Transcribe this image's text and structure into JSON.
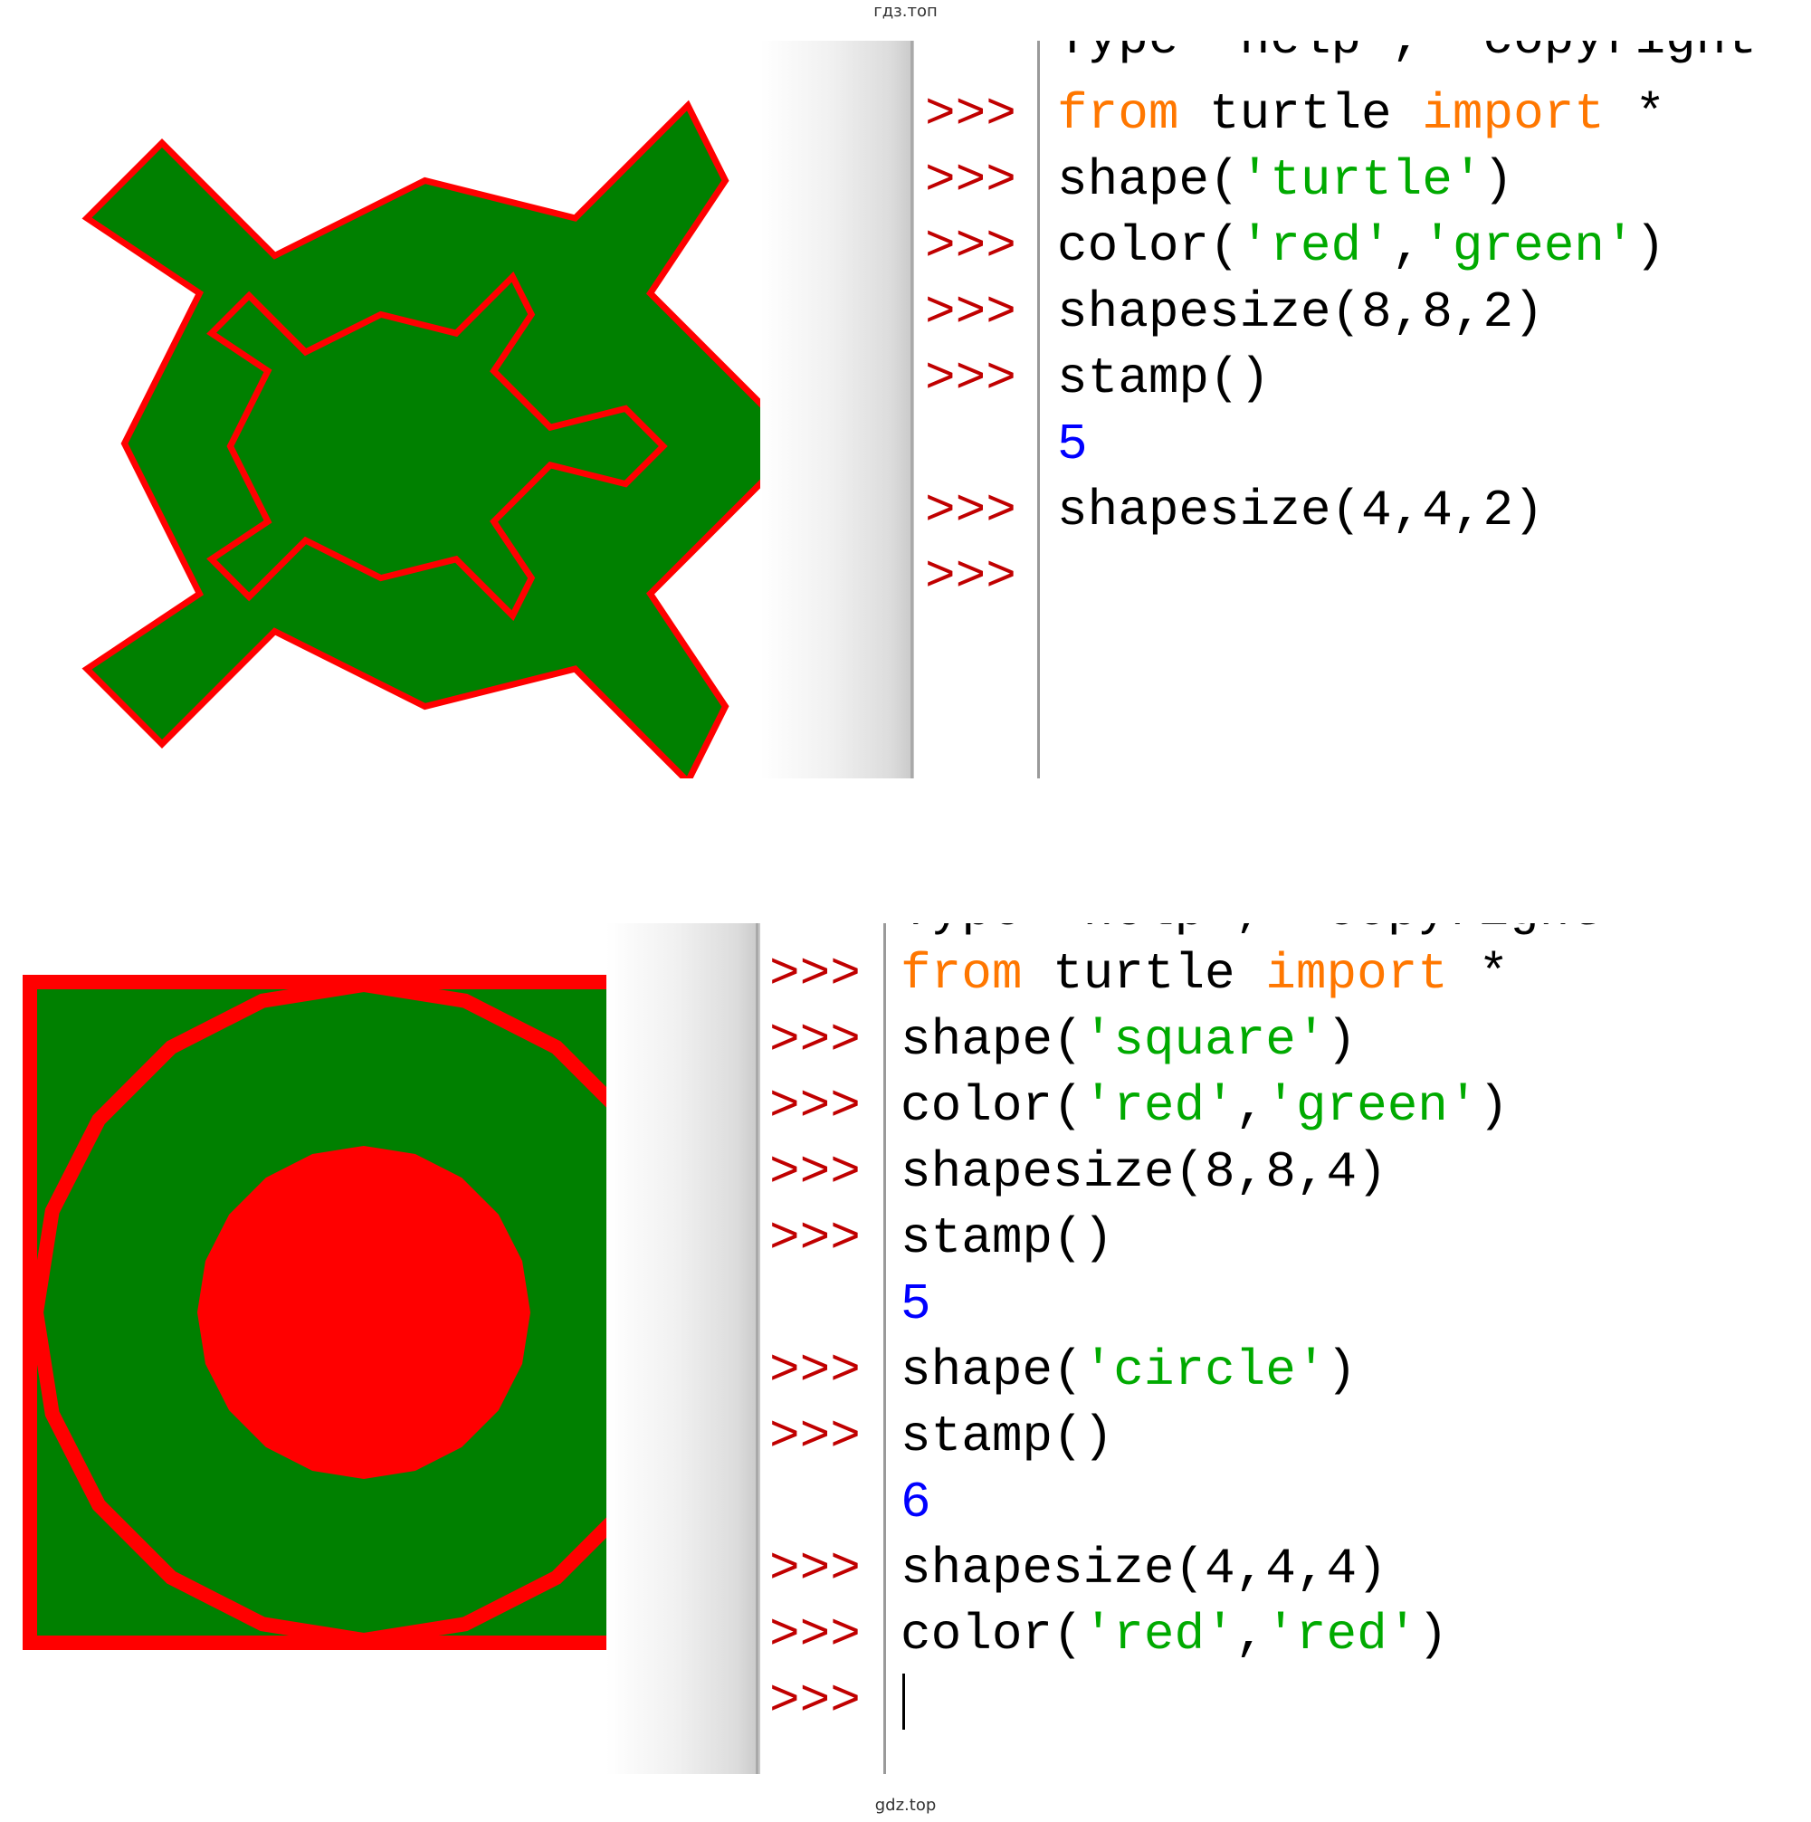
{
  "watermark_top": "гдз.топ",
  "watermark_bottom": "gdz.top",
  "colors": {
    "pen": "#ff0000",
    "fill": "#008000",
    "prompt": "#c00000",
    "keyword": "#ff7700",
    "string": "#00aa00",
    "output": "#0000ff",
    "text": "#000000"
  },
  "top_panel": {
    "cut_line": "Type \"help\", \"copyright",
    "prompt": ">>>",
    "lines": [
      {
        "kind": "code",
        "parts": [
          {
            "t": "from",
            "c": "kw"
          },
          {
            "t": " turtle ",
            "c": ""
          },
          {
            "t": "import",
            "c": "kw"
          },
          {
            "t": " *",
            "c": ""
          }
        ]
      },
      {
        "kind": "code",
        "parts": [
          {
            "t": "shape(",
            "c": ""
          },
          {
            "t": "'turtle'",
            "c": "str"
          },
          {
            "t": ")",
            "c": ""
          }
        ]
      },
      {
        "kind": "code",
        "parts": [
          {
            "t": "color(",
            "c": ""
          },
          {
            "t": "'red'",
            "c": "str"
          },
          {
            "t": ",",
            "c": ""
          },
          {
            "t": "'green'",
            "c": "str"
          },
          {
            "t": ")",
            "c": ""
          }
        ]
      },
      {
        "kind": "code",
        "parts": [
          {
            "t": "shapesize(8,8,2)",
            "c": ""
          }
        ]
      },
      {
        "kind": "code",
        "parts": [
          {
            "t": "stamp()",
            "c": ""
          }
        ]
      },
      {
        "kind": "output",
        "parts": [
          {
            "t": "5",
            "c": "out"
          }
        ]
      },
      {
        "kind": "code",
        "parts": [
          {
            "t": "shapesize(4,4,2)",
            "c": ""
          }
        ]
      },
      {
        "kind": "prompt-only",
        "parts": []
      }
    ]
  },
  "bottom_panel": {
    "cut_line": "Type \"help\", \"copyright",
    "prompt": ">>>",
    "lines": [
      {
        "kind": "code",
        "parts": [
          {
            "t": "from",
            "c": "kw"
          },
          {
            "t": " turtle ",
            "c": ""
          },
          {
            "t": "import",
            "c": "kw"
          },
          {
            "t": " *",
            "c": ""
          }
        ]
      },
      {
        "kind": "code",
        "parts": [
          {
            "t": "shape(",
            "c": ""
          },
          {
            "t": "'square'",
            "c": "str"
          },
          {
            "t": ")",
            "c": ""
          }
        ]
      },
      {
        "kind": "code",
        "parts": [
          {
            "t": "color(",
            "c": ""
          },
          {
            "t": "'red'",
            "c": "str"
          },
          {
            "t": ",",
            "c": ""
          },
          {
            "t": "'green'",
            "c": "str"
          },
          {
            "t": ")",
            "c": ""
          }
        ]
      },
      {
        "kind": "code",
        "parts": [
          {
            "t": "shapesize(8,8,4)",
            "c": ""
          }
        ]
      },
      {
        "kind": "code",
        "parts": [
          {
            "t": "stamp()",
            "c": ""
          }
        ]
      },
      {
        "kind": "output",
        "parts": [
          {
            "t": "5",
            "c": "out"
          }
        ]
      },
      {
        "kind": "code",
        "parts": [
          {
            "t": "shape(",
            "c": ""
          },
          {
            "t": "'circle'",
            "c": "str"
          },
          {
            "t": ")",
            "c": ""
          }
        ]
      },
      {
        "kind": "code",
        "parts": [
          {
            "t": "stamp()",
            "c": ""
          }
        ]
      },
      {
        "kind": "output",
        "parts": [
          {
            "t": "6",
            "c": "out"
          }
        ]
      },
      {
        "kind": "code",
        "parts": [
          {
            "t": "shapesize(4,4,4)",
            "c": ""
          }
        ]
      },
      {
        "kind": "code",
        "parts": [
          {
            "t": "color(",
            "c": ""
          },
          {
            "t": "'red'",
            "c": "str"
          },
          {
            "t": ",",
            "c": ""
          },
          {
            "t": "'red'",
            "c": "str"
          },
          {
            "t": ")",
            "c": ""
          }
        ]
      },
      {
        "kind": "prompt-cursor",
        "parts": []
      }
    ]
  }
}
